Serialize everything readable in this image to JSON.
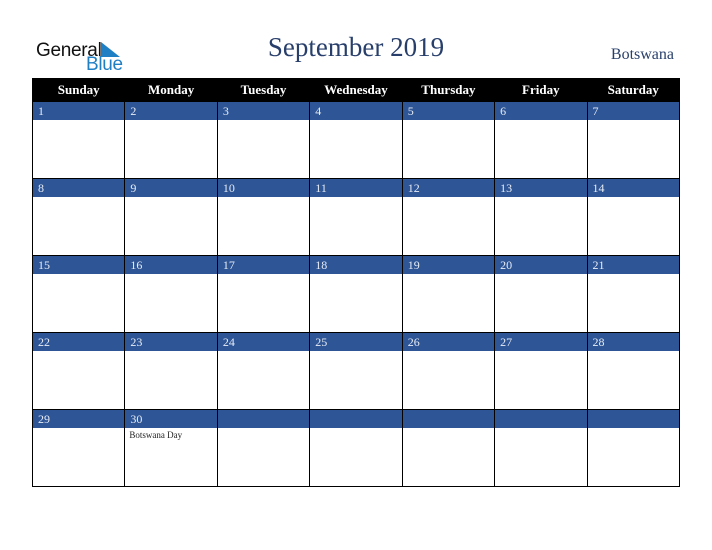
{
  "logo": {
    "word1": "General",
    "word2": "Blue"
  },
  "title": "September 2019",
  "country": "Botswana",
  "colors": {
    "header_bg": "#000000",
    "date_band": "#2e5596",
    "title": "#283f6b",
    "logo_blue": "#1f7fc4"
  },
  "weekdays": [
    "Sunday",
    "Monday",
    "Tuesday",
    "Wednesday",
    "Thursday",
    "Friday",
    "Saturday"
  ],
  "weeks": [
    [
      {
        "day": "1"
      },
      {
        "day": "2"
      },
      {
        "day": "3"
      },
      {
        "day": "4"
      },
      {
        "day": "5"
      },
      {
        "day": "6"
      },
      {
        "day": "7"
      }
    ],
    [
      {
        "day": "8"
      },
      {
        "day": "9"
      },
      {
        "day": "10"
      },
      {
        "day": "11"
      },
      {
        "day": "12"
      },
      {
        "day": "13"
      },
      {
        "day": "14"
      }
    ],
    [
      {
        "day": "15"
      },
      {
        "day": "16"
      },
      {
        "day": "17"
      },
      {
        "day": "18"
      },
      {
        "day": "19"
      },
      {
        "day": "20"
      },
      {
        "day": "21"
      }
    ],
    [
      {
        "day": "22"
      },
      {
        "day": "23"
      },
      {
        "day": "24"
      },
      {
        "day": "25"
      },
      {
        "day": "26"
      },
      {
        "day": "27"
      },
      {
        "day": "28"
      }
    ],
    [
      {
        "day": "29"
      },
      {
        "day": "30",
        "event": "Botswana Day"
      },
      {
        "day": ""
      },
      {
        "day": ""
      },
      {
        "day": ""
      },
      {
        "day": ""
      },
      {
        "day": ""
      }
    ]
  ]
}
